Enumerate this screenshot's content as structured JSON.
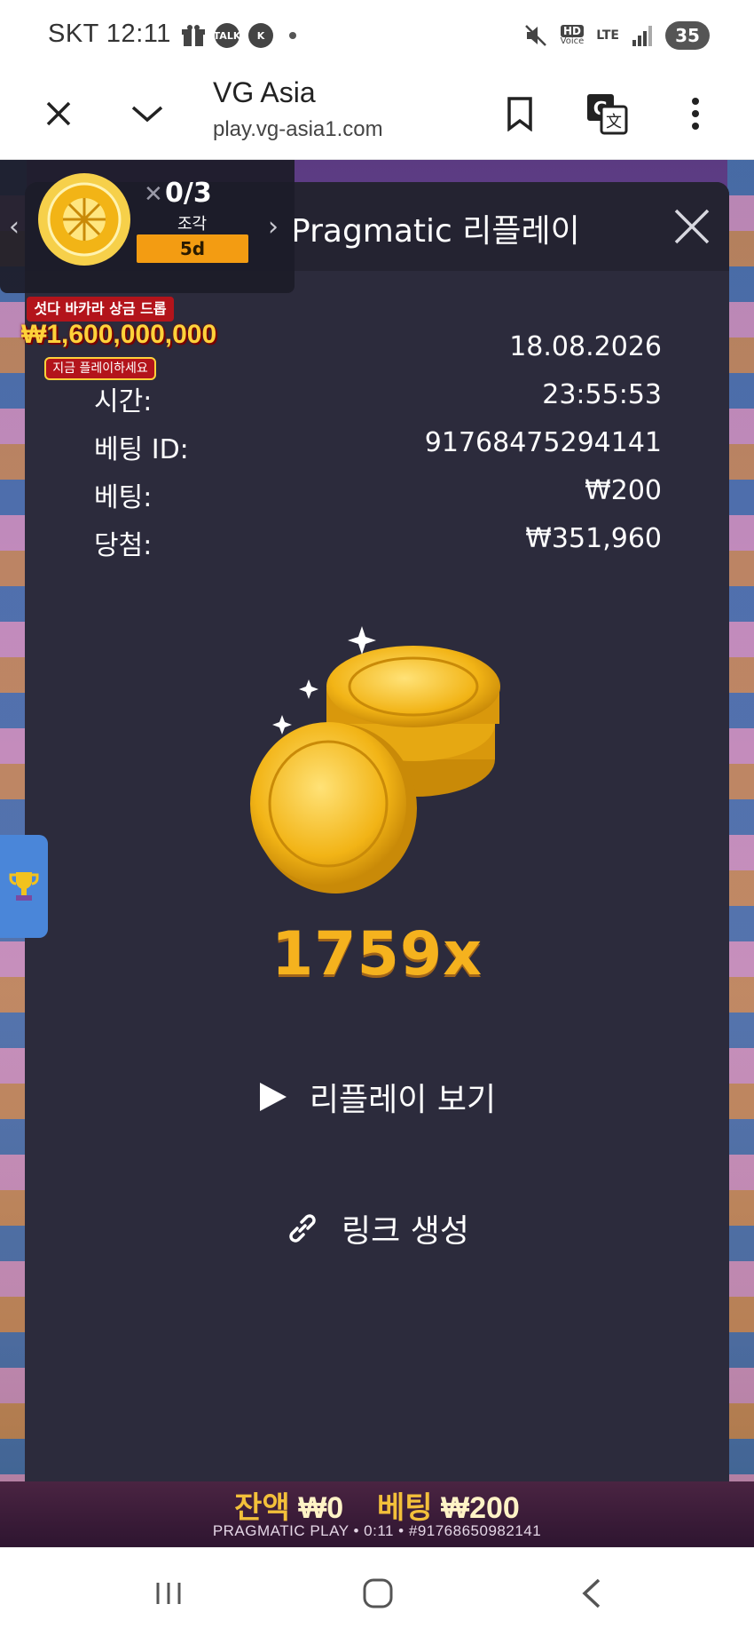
{
  "status_bar": {
    "carrier_time": "SKT 12:11",
    "talk_badge": "TALK",
    "k_badge": "K",
    "hd_voice": "HD",
    "voice_label": "Voice",
    "lte": "LTE",
    "battery": "35"
  },
  "browser": {
    "title": "VG Asia",
    "url": "play.vg-asia1.com"
  },
  "modal": {
    "title": "Pragmatic 리플레이",
    "rows": [
      {
        "label": "",
        "value": "18.08.2026"
      },
      {
        "label": "시간:",
        "value": "23:55:53"
      },
      {
        "label": "베팅 ID:",
        "value": "91768475294141"
      },
      {
        "label": "베팅:",
        "value": "₩200"
      },
      {
        "label": "당첨:",
        "value": "₩351,960"
      }
    ],
    "multiplier": "1759x",
    "watch_replay": "리플레이 보기",
    "create_link": "링크 생성"
  },
  "widget": {
    "count": "0/3",
    "sub": "조각",
    "timer": "5d"
  },
  "promo": {
    "headline": "섯다 바카라 상금 드롭",
    "amount": "₩1,600,000,000",
    "cta": "지금 플레이하세요"
  },
  "game_bar": {
    "balance_label": "잔액",
    "balance_value": "₩0",
    "bet_label": "베팅",
    "bet_value": "₩200",
    "footer": "PRAGMATIC PLAY • 0:11 • #91768650982141"
  },
  "colors": {
    "modal_bg": "#2c2b3c",
    "header_bg": "#242331",
    "multiplier": "#f5b21e",
    "timer_badge": "#f39c12"
  }
}
